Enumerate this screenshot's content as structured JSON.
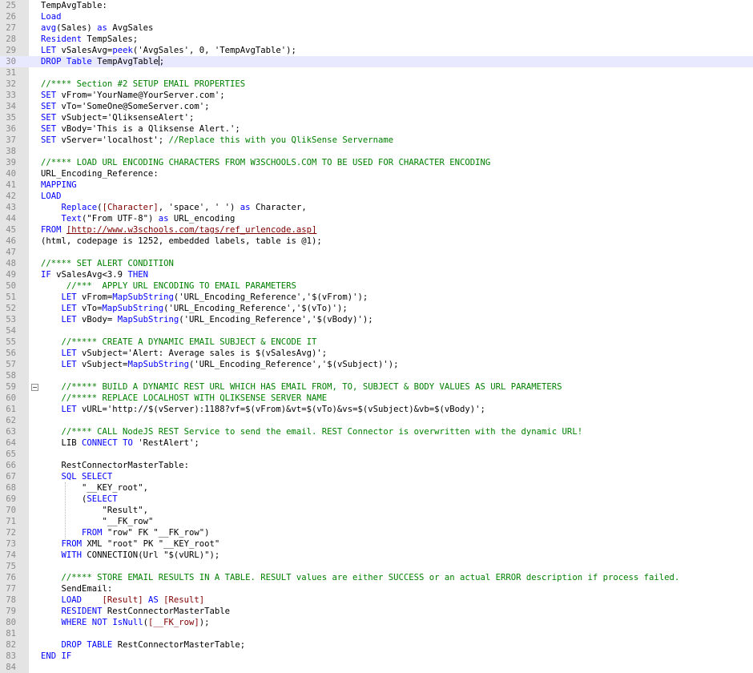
{
  "editor": {
    "current_line": 30,
    "colors": {
      "keyword": "#0000ff",
      "comment": "#008000",
      "field": "#800000",
      "plain": "#000000",
      "current_line_bg": "#e8e8ff",
      "gutter_bg": "#e4e4e4",
      "line_number": "#8a8a8a"
    },
    "fold_icon": "fold-collapse-icon",
    "lines": [
      {
        "n": "25",
        "indent": "",
        "tokens": [
          [
            "pl",
            "TempAvgTable:"
          ]
        ]
      },
      {
        "n": "26",
        "indent": "",
        "tokens": [
          [
            "kw",
            "Load"
          ]
        ]
      },
      {
        "n": "27",
        "indent": "",
        "tokens": [
          [
            "fn",
            "avg"
          ],
          [
            "pl",
            "(Sales) "
          ],
          [
            "kw",
            "as"
          ],
          [
            "pl",
            " AvgSales"
          ]
        ]
      },
      {
        "n": "28",
        "indent": "",
        "tokens": [
          [
            "kw",
            "Resident"
          ],
          [
            "pl",
            " TempSales;"
          ]
        ]
      },
      {
        "n": "29",
        "indent": "",
        "tokens": [
          [
            "kw",
            "LET"
          ],
          [
            "pl",
            " vSalesAvg="
          ],
          [
            "fn",
            "peek"
          ],
          [
            "pl",
            "('AvgSales', 0, 'TempAvgTable');"
          ]
        ]
      },
      {
        "n": "30",
        "indent": "",
        "tokens": [
          [
            "kw",
            "DROP"
          ],
          [
            "pl",
            " "
          ],
          [
            "kw",
            "Table"
          ],
          [
            "pl",
            " TempAvgTable"
          ],
          [
            "caret",
            ""
          ],
          [
            "pl",
            ";"
          ]
        ]
      },
      {
        "n": "31",
        "indent": "",
        "tokens": []
      },
      {
        "n": "32",
        "indent": "",
        "tokens": [
          [
            "cmt",
            "//**** Section #2 SETUP EMAIL PROPERTIES"
          ]
        ]
      },
      {
        "n": "33",
        "indent": "",
        "tokens": [
          [
            "kw",
            "SET"
          ],
          [
            "pl",
            " vFrom='YourName@YourServer.com';"
          ]
        ]
      },
      {
        "n": "34",
        "indent": "",
        "tokens": [
          [
            "kw",
            "SET"
          ],
          [
            "pl",
            " vTo='SomeOne@SomeServer.com';"
          ]
        ]
      },
      {
        "n": "35",
        "indent": "",
        "tokens": [
          [
            "kw",
            "SET"
          ],
          [
            "pl",
            " vSubject='QliksenseAlert';"
          ]
        ]
      },
      {
        "n": "36",
        "indent": "",
        "tokens": [
          [
            "kw",
            "SET"
          ],
          [
            "pl",
            " vBody='This is a Qliksense Alert.';"
          ]
        ]
      },
      {
        "n": "37",
        "indent": "",
        "tokens": [
          [
            "kw",
            "SET"
          ],
          [
            "pl",
            " vServer='localhost'; "
          ],
          [
            "cmt",
            "//Replace this with you QlikSense Servername"
          ]
        ]
      },
      {
        "n": "38",
        "indent": "",
        "tokens": []
      },
      {
        "n": "39",
        "indent": "",
        "tokens": [
          [
            "cmt",
            "//**** LOAD URL ENCODING CHARACTERS FROM W3SCHOOLS.COM TO BE USED FOR CHARACTER ENCODING"
          ]
        ]
      },
      {
        "n": "40",
        "indent": "",
        "tokens": [
          [
            "pl",
            "URL_Encoding_Reference:"
          ]
        ]
      },
      {
        "n": "41",
        "indent": "",
        "tokens": [
          [
            "kw",
            "MAPPING"
          ]
        ]
      },
      {
        "n": "42",
        "indent": "",
        "tokens": [
          [
            "kw",
            "LOAD"
          ]
        ]
      },
      {
        "n": "43",
        "indent": "    ",
        "tokens": [
          [
            "fn",
            "Replace"
          ],
          [
            "pl",
            "("
          ],
          [
            "fld",
            "[Character]"
          ],
          [
            "pl",
            ", 'space', ' ') "
          ],
          [
            "kw",
            "as"
          ],
          [
            "pl",
            " Character,"
          ]
        ]
      },
      {
        "n": "44",
        "indent": "    ",
        "tokens": [
          [
            "fn",
            "Text"
          ],
          [
            "pl",
            "(\"From UTF-8\") "
          ],
          [
            "kw",
            "as"
          ],
          [
            "pl",
            " URL_encoding"
          ]
        ]
      },
      {
        "n": "45",
        "indent": "",
        "tokens": [
          [
            "kw",
            "FROM"
          ],
          [
            "pl",
            " "
          ],
          [
            "url",
            "[http://www.w3schools.com/tags/ref_urlencode.asp]"
          ]
        ]
      },
      {
        "n": "46",
        "indent": "",
        "tokens": [
          [
            "pl",
            "(html, codepage is 1252, embedded labels, table is @1);"
          ]
        ]
      },
      {
        "n": "47",
        "indent": "",
        "tokens": []
      },
      {
        "n": "48",
        "indent": "",
        "tokens": [
          [
            "cmt",
            "//**** SET ALERT CONDITION"
          ]
        ]
      },
      {
        "n": "49",
        "indent": "",
        "tokens": [
          [
            "kw",
            "IF"
          ],
          [
            "pl",
            " vSalesAvg<3.9 "
          ],
          [
            "kw",
            "THEN"
          ]
        ]
      },
      {
        "n": "50",
        "indent": "     ",
        "tokens": [
          [
            "cmt",
            "//***  APPLY URL ENCODING TO EMAIL PARAMETERS"
          ]
        ]
      },
      {
        "n": "51",
        "indent": "    ",
        "tokens": [
          [
            "kw",
            "LET"
          ],
          [
            "pl",
            " vFrom="
          ],
          [
            "fn",
            "MapSubString"
          ],
          [
            "pl",
            "('URL_Encoding_Reference','$(vFrom)');"
          ]
        ]
      },
      {
        "n": "52",
        "indent": "    ",
        "tokens": [
          [
            "kw",
            "LET"
          ],
          [
            "pl",
            " vTo="
          ],
          [
            "fn",
            "MapSubString"
          ],
          [
            "pl",
            "('URL_Encoding_Reference','$(vTo)');"
          ]
        ]
      },
      {
        "n": "53",
        "indent": "    ",
        "tokens": [
          [
            "kw",
            "LET"
          ],
          [
            "pl",
            " vBody= "
          ],
          [
            "fn",
            "MapSubString"
          ],
          [
            "pl",
            "('URL_Encoding_Reference','$(vBody)');"
          ]
        ]
      },
      {
        "n": "54",
        "indent": "",
        "tokens": []
      },
      {
        "n": "55",
        "indent": "    ",
        "tokens": [
          [
            "cmt",
            "//***** CREATE A DYNAMIC EMAIL SUBJECT & ENCODE IT"
          ]
        ]
      },
      {
        "n": "56",
        "indent": "    ",
        "tokens": [
          [
            "kw",
            "LET"
          ],
          [
            "pl",
            " vSubject='Alert: Average sales is $(vSalesAvg)';"
          ]
        ]
      },
      {
        "n": "57",
        "indent": "    ",
        "tokens": [
          [
            "kw",
            "LET"
          ],
          [
            "pl",
            " vSubject="
          ],
          [
            "fn",
            "MapSubString"
          ],
          [
            "pl",
            "('URL_Encoding_Reference','$(vSubject)');"
          ]
        ]
      },
      {
        "n": "58",
        "indent": "",
        "tokens": []
      },
      {
        "n": "59",
        "indent": "    ",
        "fold": true,
        "tokens": [
          [
            "cmt",
            "//***** BUILD A DYNAMIC REST URL WHICH HAS EMAIL FROM, TO, SUBJECT & BODY VALUES AS URL PARAMETERS"
          ]
        ]
      },
      {
        "n": "60",
        "indent": "    ",
        "tokens": [
          [
            "cmt",
            "//***** REPLACE LOCALHOST WITH QLIKSENSE SERVER NAME"
          ]
        ]
      },
      {
        "n": "61",
        "indent": "    ",
        "tokens": [
          [
            "kw",
            "LET"
          ],
          [
            "pl",
            " vURL='http://$(vServer):1188?vf=$(vFrom)&vt=$(vTo)&vs=$(vSubject)&vb=$(vBody)';"
          ]
        ]
      },
      {
        "n": "62",
        "indent": "",
        "tokens": []
      },
      {
        "n": "63",
        "indent": "    ",
        "tokens": [
          [
            "cmt",
            "//**** CALL NodeJS REST Service to send the email. REST Connector is overwritten with the dynamic URL!"
          ]
        ]
      },
      {
        "n": "64",
        "indent": "    ",
        "tokens": [
          [
            "pl",
            "LIB "
          ],
          [
            "kw",
            "CONNECT"
          ],
          [
            "pl",
            " "
          ],
          [
            "kw",
            "TO"
          ],
          [
            "pl",
            " 'RestAlert';"
          ]
        ]
      },
      {
        "n": "65",
        "indent": "",
        "tokens": []
      },
      {
        "n": "66",
        "indent": "    ",
        "tokens": [
          [
            "pl",
            "RestConnectorMasterTable:"
          ]
        ]
      },
      {
        "n": "67",
        "indent": "    ",
        "tokens": [
          [
            "kw",
            "SQL"
          ],
          [
            "pl",
            " "
          ],
          [
            "kw",
            "SELECT"
          ]
        ]
      },
      {
        "n": "68",
        "indent": "        ",
        "tokens": [
          [
            "pl",
            "\"__KEY_root\","
          ]
        ]
      },
      {
        "n": "69",
        "indent": "        ",
        "tokens": [
          [
            "pl",
            "("
          ],
          [
            "kw",
            "SELECT"
          ]
        ]
      },
      {
        "n": "70",
        "indent": "            ",
        "tokens": [
          [
            "pl",
            "\"Result\","
          ]
        ]
      },
      {
        "n": "71",
        "indent": "            ",
        "tokens": [
          [
            "pl",
            "\"__FK_row\""
          ]
        ]
      },
      {
        "n": "72",
        "indent": "        ",
        "tokens": [
          [
            "kw",
            "FROM"
          ],
          [
            "pl",
            " \"row\" FK \"__FK_row\")"
          ]
        ]
      },
      {
        "n": "73",
        "indent": "    ",
        "tokens": [
          [
            "kw",
            "FROM"
          ],
          [
            "pl",
            " XML \"root\" PK \"__KEY_root\""
          ]
        ]
      },
      {
        "n": "74",
        "indent": "    ",
        "tokens": [
          [
            "kw",
            "WITH"
          ],
          [
            "pl",
            " CONNECTION(Url \"$(vURL)\");"
          ]
        ]
      },
      {
        "n": "75",
        "indent": "",
        "tokens": []
      },
      {
        "n": "76",
        "indent": "    ",
        "tokens": [
          [
            "cmt",
            "//**** STORE EMAIL RESULTS IN A TABLE. RESULT values are either SUCCESS or an actual ERROR description if process failed."
          ]
        ]
      },
      {
        "n": "77",
        "indent": "    ",
        "tokens": [
          [
            "pl",
            "SendEmail:"
          ]
        ]
      },
      {
        "n": "78",
        "indent": "    ",
        "tokens": [
          [
            "kw",
            "LOAD"
          ],
          [
            "pl",
            "    "
          ],
          [
            "fld",
            "[Result]"
          ],
          [
            "pl",
            " "
          ],
          [
            "kw",
            "AS"
          ],
          [
            "pl",
            " "
          ],
          [
            "fld",
            "[Result]"
          ]
        ]
      },
      {
        "n": "79",
        "indent": "    ",
        "tokens": [
          [
            "kw",
            "RESIDENT"
          ],
          [
            "pl",
            " RestConnectorMasterTable"
          ]
        ]
      },
      {
        "n": "80",
        "indent": "    ",
        "tokens": [
          [
            "kw",
            "WHERE"
          ],
          [
            "pl",
            " "
          ],
          [
            "kw",
            "NOT"
          ],
          [
            "pl",
            " "
          ],
          [
            "fn",
            "IsNull"
          ],
          [
            "pl",
            "("
          ],
          [
            "fld",
            "[__FK_row]"
          ],
          [
            "pl",
            ");"
          ]
        ]
      },
      {
        "n": "81",
        "indent": "",
        "tokens": []
      },
      {
        "n": "82",
        "indent": "    ",
        "tokens": [
          [
            "kw",
            "DROP"
          ],
          [
            "pl",
            " "
          ],
          [
            "kw",
            "TABLE"
          ],
          [
            "pl",
            " RestConnectorMasterTable;"
          ]
        ]
      },
      {
        "n": "83",
        "indent": "",
        "tokens": [
          [
            "kw",
            "END"
          ],
          [
            "pl",
            " "
          ],
          [
            "kw",
            "IF"
          ]
        ]
      },
      {
        "n": "84",
        "indent": "",
        "tokens": []
      }
    ]
  }
}
